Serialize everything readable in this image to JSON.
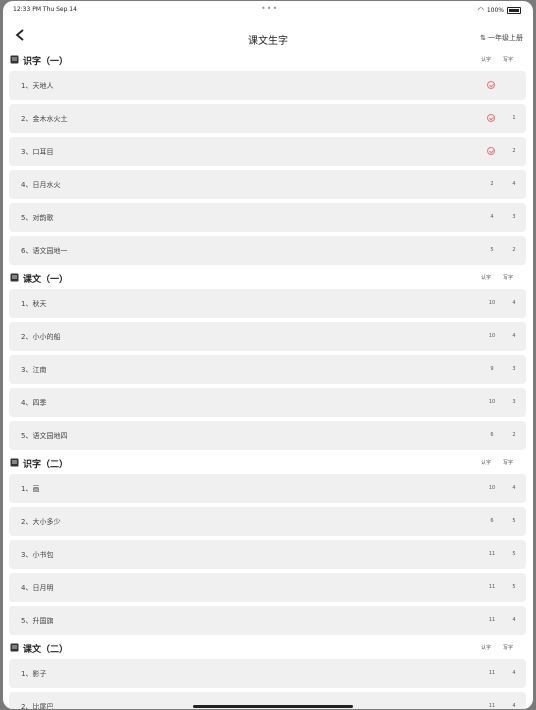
{
  "status": {
    "time": "12:33 PM  Thu Sep 14",
    "dots": "•••",
    "battery": "100%"
  },
  "nav": {
    "title": "课文生字",
    "grade_icon": "⇅",
    "grade": "一年级上册"
  },
  "columns": {
    "recognize": "认字",
    "write": "写字"
  },
  "sections": [
    {
      "title": "识字（一）",
      "rows": [
        {
          "label": "1、天地人",
          "v1": "",
          "v2": "",
          "check": true
        },
        {
          "label": "2、金木水火土",
          "v1": "",
          "v2": "1",
          "check": true
        },
        {
          "label": "3、口耳目",
          "v1": "",
          "v2": "2",
          "check": true
        },
        {
          "label": "4、日月水火",
          "v1": "2",
          "v2": "4",
          "check": false
        },
        {
          "label": "5、对韵歌",
          "v1": "4",
          "v2": "3",
          "check": false
        },
        {
          "label": "6、语文园地一",
          "v1": "5",
          "v2": "2",
          "check": false
        }
      ]
    },
    {
      "title": "课文（一）",
      "rows": [
        {
          "label": "1、秋天",
          "v1": "10",
          "v2": "4",
          "check": false
        },
        {
          "label": "2、小小的船",
          "v1": "10",
          "v2": "4",
          "check": false
        },
        {
          "label": "3、江南",
          "v1": "9",
          "v2": "3",
          "check": false
        },
        {
          "label": "4、四季",
          "v1": "10",
          "v2": "3",
          "check": false
        },
        {
          "label": "5、语文园地四",
          "v1": "6",
          "v2": "2",
          "check": false
        }
      ]
    },
    {
      "title": "识字（二）",
      "rows": [
        {
          "label": "1、画",
          "v1": "10",
          "v2": "4",
          "check": false
        },
        {
          "label": "2、大小多少",
          "v1": "6",
          "v2": "5",
          "check": false
        },
        {
          "label": "3、小书包",
          "v1": "11",
          "v2": "5",
          "check": false
        },
        {
          "label": "4、日月明",
          "v1": "11",
          "v2": "5",
          "check": false
        },
        {
          "label": "5、升国旗",
          "v1": "11",
          "v2": "4",
          "check": false
        }
      ]
    },
    {
      "title": "课文（二）",
      "rows": [
        {
          "label": "1、影子",
          "v1": "11",
          "v2": "4",
          "check": false
        },
        {
          "label": "2、比尾巴",
          "v1": "11",
          "v2": "4",
          "check": false
        }
      ]
    }
  ]
}
